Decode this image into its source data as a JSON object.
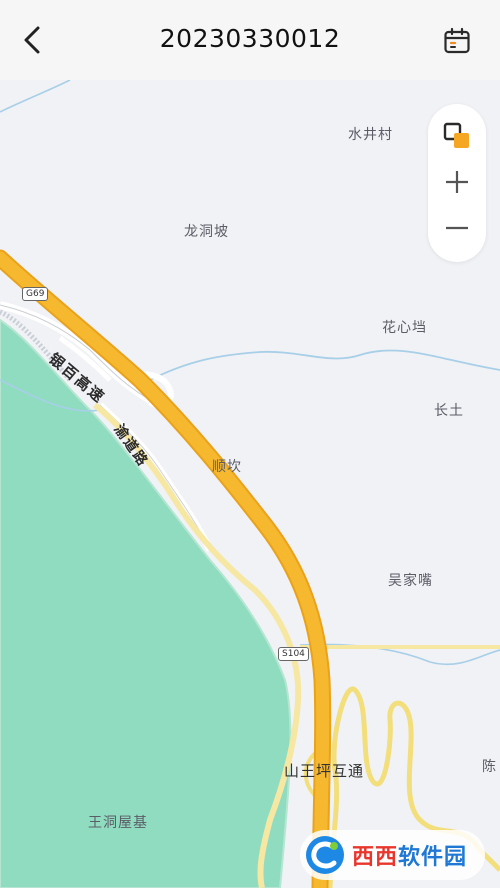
{
  "header": {
    "title": "20230330012",
    "back_icon": "chevron-left-icon",
    "calendar_icon": "calendar-icon"
  },
  "map": {
    "colors": {
      "land": "#f1f2f6",
      "forest": "#8fdcc0",
      "highway": "#f5b82e",
      "highway_edge": "#e9a21a",
      "secondary_road": "#f6e7a3",
      "river": "#a8cfe8",
      "local_road": "#ffffff"
    },
    "places": {
      "shuijingcun": "水井村",
      "longdongpo": "龙洞坡",
      "huaxindang": "花心垱",
      "changtu": "长土",
      "shunkan": "顺坎",
      "wujiazui": "吴家嘴",
      "shanwangping": "山王坪互通",
      "wangdongwuji": "王洞屋基",
      "chen": "陈"
    },
    "roads": {
      "highway_name": "银百高速",
      "local_road_name": "渝道路",
      "shield_g69": "G69",
      "shield_s104": "S104"
    },
    "controls": {
      "layers_icon": "layers-icon",
      "zoom_in_icon": "plus-icon",
      "zoom_out_icon": "minus-icon"
    },
    "watermark": {
      "logo": "c-logo-icon",
      "text_a": "西西",
      "text_b": "软件园"
    }
  }
}
